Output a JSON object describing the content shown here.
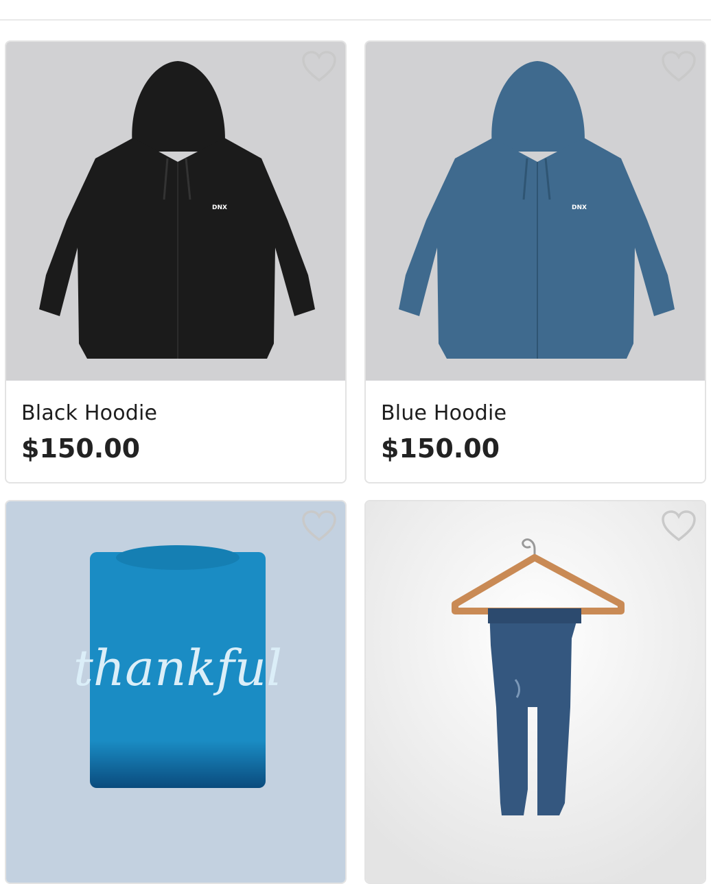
{
  "products": [
    {
      "name": "Black Hoodie",
      "price": "$150.00",
      "favorite_icon": "heart-outline-icon",
      "image": "black-hoodie"
    },
    {
      "name": "Blue Hoodie",
      "price": "$150.00",
      "favorite_icon": "heart-outline-icon",
      "image": "blue-hoodie"
    },
    {
      "name": "",
      "price": "",
      "favorite_icon": "heart-outline-icon",
      "image": "thankful-tshirt",
      "image_text": "thankful"
    },
    {
      "name": "",
      "price": "",
      "favorite_icon": "heart-outline-icon",
      "image": "jeans-on-hanger"
    }
  ],
  "colors": {
    "card_border": "#e3e3e3",
    "heart_stroke": "#c9c9c9",
    "black_hoodie": "#1b1b1b",
    "blue_hoodie": "#3f6a8e",
    "tshirt": "#1a8cc4",
    "denim": "#34577f"
  }
}
